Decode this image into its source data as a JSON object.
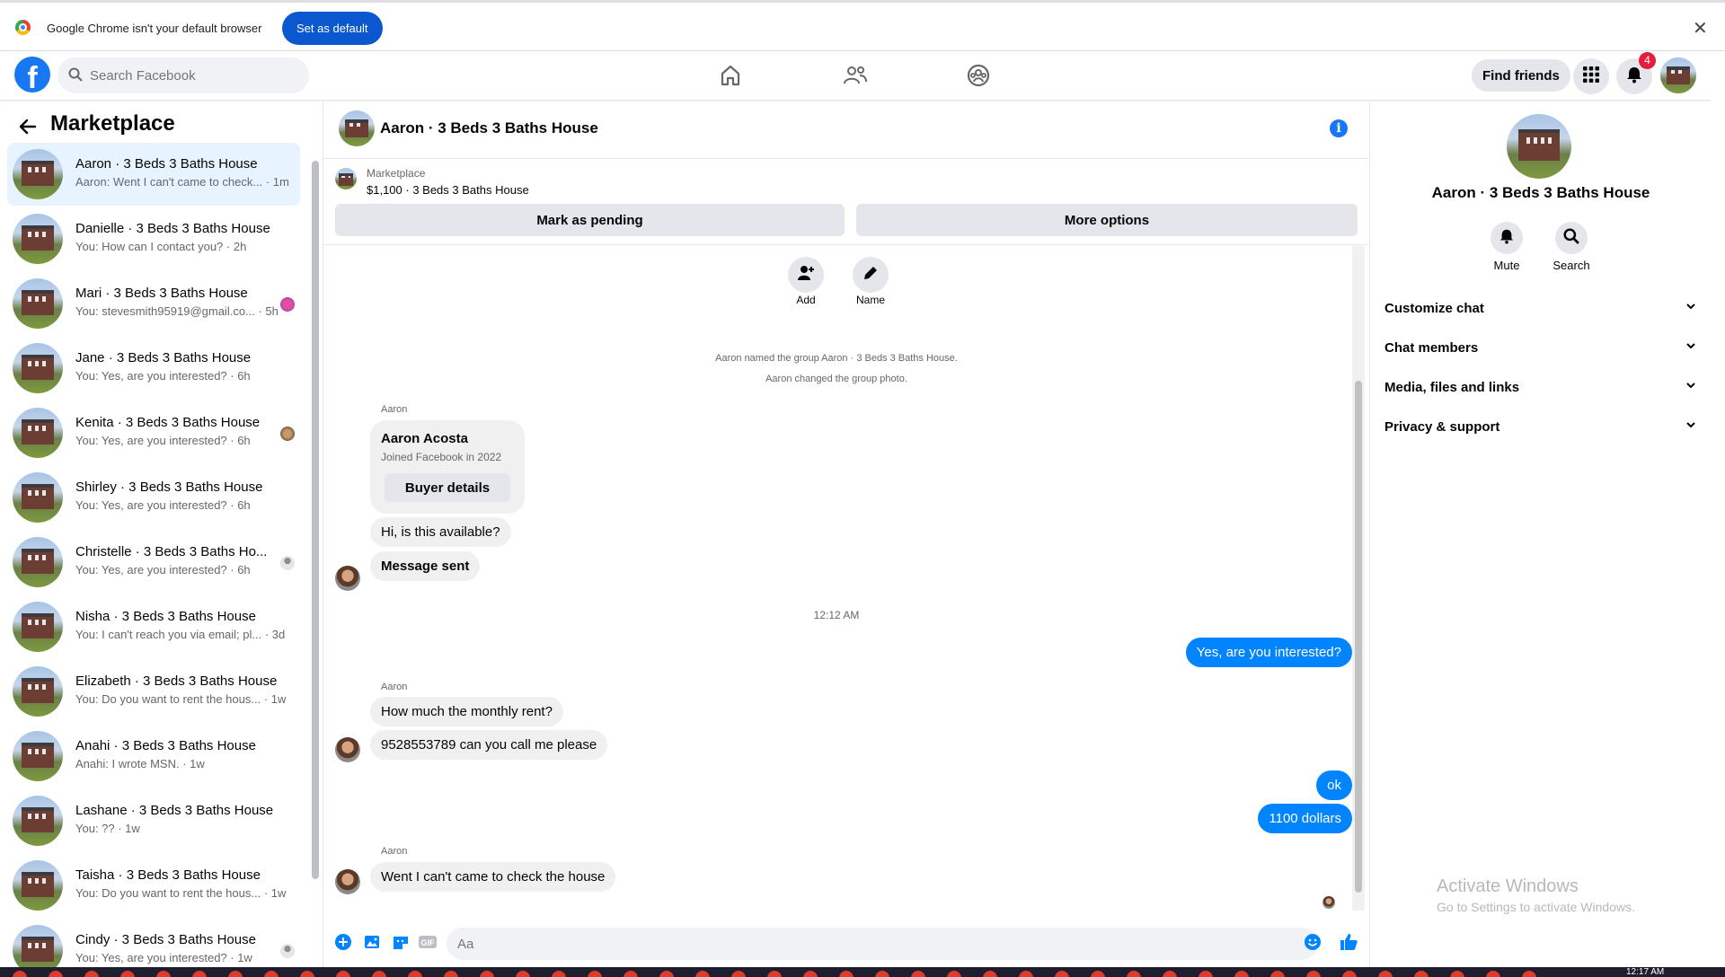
{
  "banner": {
    "message": "Google Chrome isn't your default browser",
    "set_default_label": "Set as default",
    "close_glyph": "✕"
  },
  "topnav": {
    "logo_letter": "f",
    "search_placeholder": "Search Facebook",
    "find_friends_label": "Find friends",
    "notifications_count": "4"
  },
  "sidebar": {
    "title": "Marketplace",
    "conversations": [
      {
        "name": "Aaron · 3 Beds 3 Baths House",
        "preview": "Aaron: Went I can't came to check... · 1m"
      },
      {
        "name": "Danielle · 3 Beds 3 Baths House",
        "preview": "You: How can I contact you? · 2h"
      },
      {
        "name": "Mari · 3 Beds 3 Baths House",
        "preview": "You: stevesmith95919@gmail.co... · 5h"
      },
      {
        "name": "Jane · 3 Beds 3 Baths House",
        "preview": "You: Yes, are you interested? · 6h"
      },
      {
        "name": "Kenita · 3 Beds 3 Baths House",
        "preview": "You: Yes, are you interested? · 6h"
      },
      {
        "name": "Shirley · 3 Beds 3 Baths House",
        "preview": "You: Yes, are you interested? · 6h"
      },
      {
        "name": "Christelle · 3 Beds 3 Baths Ho...",
        "preview": "You: Yes, are you interested? · 6h"
      },
      {
        "name": "Nisha · 3 Beds 3 Baths House",
        "preview": "You: I can't reach you via email; pl... · 3d"
      },
      {
        "name": "Elizabeth · 3 Beds 3 Baths House",
        "preview": "You: Do you want to rent the hous... · 1w"
      },
      {
        "name": "Anahi · 3 Beds 3 Baths House",
        "preview": "Anahi: I wrote MSN. · 1w"
      },
      {
        "name": "Lashane · 3 Beds 3 Baths House",
        "preview": "You: ?? · 1w"
      },
      {
        "name": "Taisha · 3 Beds 3 Baths House",
        "preview": "You: Do you want to rent the hous... · 1w"
      },
      {
        "name": "Cindy · 3 Beds 3 Baths House",
        "preview": "You: Yes, are you interested? · 1w"
      }
    ]
  },
  "chat": {
    "title": "Aaron · 3 Beds 3 Baths House",
    "info_glyph": "i",
    "marketplace_label": "Marketplace",
    "listing": "$1,100 · 3 Beds 3 Baths House",
    "mark_pending_label": "Mark as pending",
    "more_options_label": "More options",
    "add_label": "Add",
    "name_label": "Name",
    "system_1": "Aaron named the group Aaron · 3 Beds 3 Baths House.",
    "system_2": "Aaron changed the group photo.",
    "sender": "Aaron",
    "card_name": "Aaron Acosta",
    "card_joined": "Joined Facebook in 2022",
    "buyer_details_label": "Buyer details",
    "msg_available": "Hi, is this available?",
    "msg_sent": "Message sent",
    "time_sep": "12:12 AM",
    "out_interested": "Yes, are you interested?",
    "in_rent": "How much the monthly rent?",
    "in_phone": "9528553789 can you call me please",
    "out_ok": "ok",
    "out_dollars": "1100 dollars",
    "in_last": "Went I can't came to check the house",
    "composer_placeholder": "Aa",
    "gif_label": "GIF"
  },
  "right_panel": {
    "title": "Aaron · 3 Beds 3 Baths House",
    "mute_label": "Mute",
    "search_label": "Search",
    "sections": [
      "Customize chat",
      "Chat members",
      "Media, files and links",
      "Privacy & support"
    ]
  },
  "watermark": {
    "line1": "Activate Windows",
    "line2": "Go to Settings to activate Windows."
  },
  "taskbar": {
    "clock": "12:17 AM"
  },
  "colors": {
    "fb_blue": "#1877f2",
    "messenger_blue": "#0084ff",
    "badge_red": "#e41e3f"
  }
}
